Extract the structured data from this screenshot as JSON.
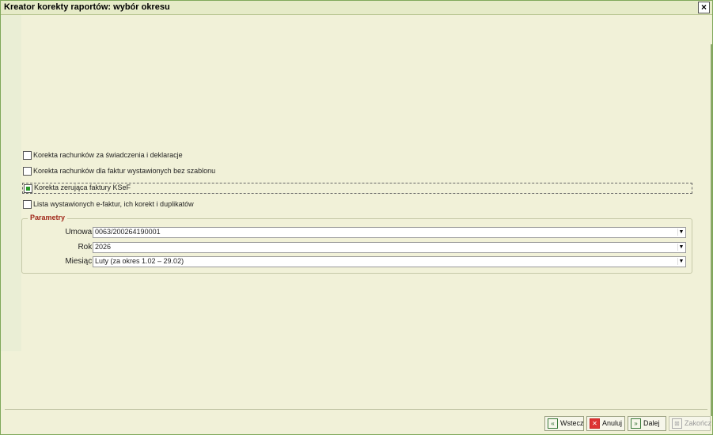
{
  "window": {
    "title": "Kreator korekty raportów: wybór okresu",
    "close_glyph": "×"
  },
  "options": [
    {
      "label": "Korekta rachunków za świadczenia i deklaracje",
      "checked": false
    },
    {
      "label": "Korekta rachunków dla faktur wystawionych bez szablonu",
      "checked": false
    },
    {
      "label": "Korekta zerująca faktury KSeF",
      "checked": true
    },
    {
      "label": "Lista wystawionych e-faktur, ich korekt i duplikatów",
      "checked": false
    }
  ],
  "params": {
    "legend": "Parametry",
    "umowa": {
      "label": "Umowa:",
      "value": "0063/200264190001"
    },
    "rok": {
      "label": "Rok:",
      "value": "2026"
    },
    "miesiac": {
      "label": "Miesiąc:",
      "value": "Luty (za okres 1.02 – 29.02)"
    }
  },
  "buttons": {
    "back": "Wstecz",
    "cancel": "Anuluj",
    "next": "Dalej",
    "finish": "Zakończ"
  },
  "colors": {
    "legend": "#a0281a",
    "checkbox_mark": "#2a9a2a",
    "cancel_icon": "#d33333"
  }
}
